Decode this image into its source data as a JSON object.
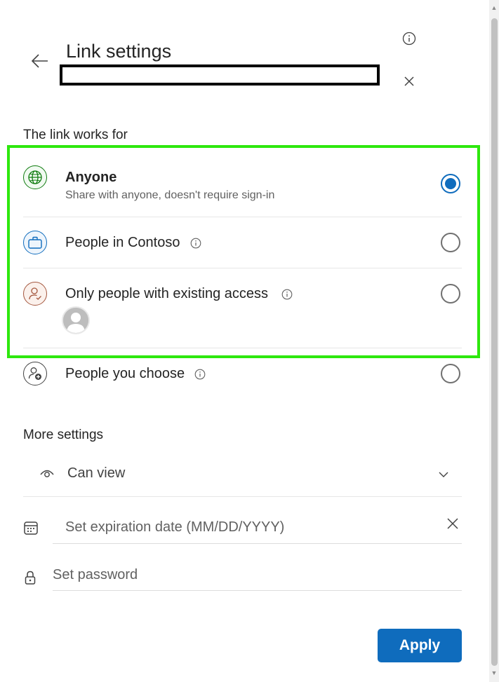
{
  "header": {
    "title": "Link settings"
  },
  "link_works_for": {
    "section_title": "The link works for",
    "options": [
      {
        "label": "Anyone",
        "subtitle": "Share with anyone, doesn't require sign-in",
        "selected": true
      },
      {
        "label": "People in Contoso",
        "selected": false
      },
      {
        "label": "Only people with existing access",
        "selected": false
      },
      {
        "label": "People you choose",
        "selected": false
      }
    ]
  },
  "more_settings": {
    "section_title": "More settings",
    "permission": "Can view",
    "expiration_placeholder": "Set expiration date (MM/DD/YYYY)",
    "password_placeholder": "Set password"
  },
  "footer": {
    "apply_label": "Apply"
  },
  "colors": {
    "accent": "#0f6cbd",
    "highlight": "#2ee80e",
    "globe_green": "#107c10",
    "briefcase_blue": "#0f6cbd",
    "person_brown": "#a4573e"
  }
}
